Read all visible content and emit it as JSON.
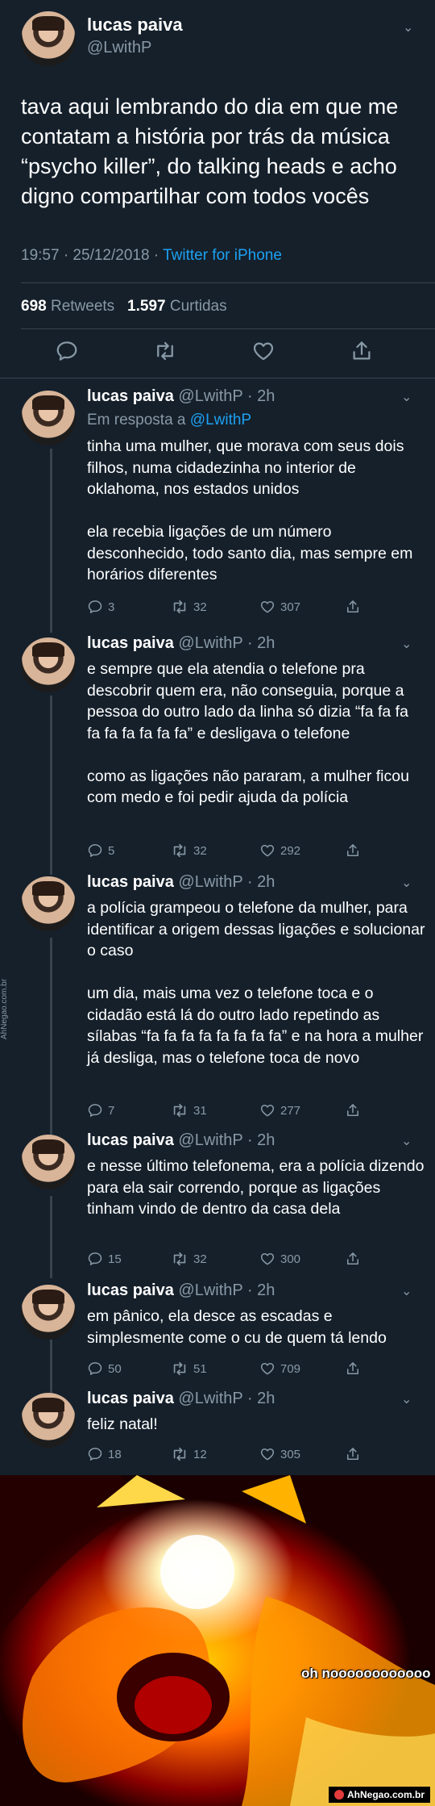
{
  "main_tweet": {
    "name": "lucas paiva",
    "handle": "@LwithP",
    "text": "tava aqui lembrando do dia em que me contatam a história por trás da música “psycho killer”, do talking heads e acho digno compartilhar com todos vocês",
    "time": "19:57 · 25/12/2018 · ",
    "client": "Twitter for iPhone",
    "retweets_count": "698",
    "retweets_label": "Retweets",
    "likes_count": "1.597",
    "likes_label": "Curtidas"
  },
  "replies": [
    {
      "name": "lucas paiva",
      "handle": "@LwithP · 2h",
      "in_reply_prefix": "Em resposta a ",
      "in_reply_to": "@LwithP",
      "text": "tinha uma mulher, que morava com seus dois filhos, numa cidadezinha no interior de oklahoma, nos estados unidos\n\nela recebia ligações de um número desconhecido, todo santo dia, mas sempre em horários diferentes",
      "replies": "3",
      "retweets": "32",
      "likes": "307"
    },
    {
      "name": "lucas paiva",
      "handle": "@LwithP · 2h",
      "text": "e sempre que ela atendia o telefone pra descobrir quem era, não conseguia, porque a pessoa do outro lado da linha só dizia “fa fa fa fa fa fa fa fa fa” e desligava o telefone\n\ncomo as ligações não pararam, a mulher ficou com medo e foi pedir ajuda da polícia",
      "replies": "5",
      "retweets": "32",
      "likes": "292"
    },
    {
      "name": "lucas paiva",
      "handle": "@LwithP · 2h",
      "text": "a polícia grampeou o telefone da mulher, para identificar a origem dessas ligações e solucionar o caso\n\num dia, mais uma vez o telefone toca e o cidadão está lá do outro lado repetindo as sílabas “fa fa fa fa fa fa fa fa” e na hora a mulher já desliga, mas o telefone toca de novo",
      "replies": "7",
      "retweets": "31",
      "likes": "277"
    },
    {
      "name": "lucas paiva",
      "handle": "@LwithP · 2h",
      "text": "e nesse último telefonema, era a polícia dizendo para ela sair correndo, porque as ligações tinham vindo de dentro da casa dela",
      "replies": "15",
      "retweets": "32",
      "likes": "300"
    },
    {
      "name": "lucas paiva",
      "handle": "@LwithP · 2h",
      "text": "em pânico, ela desce as escadas e simplesmente come o cu de quem tá lendo",
      "replies": "50",
      "retweets": "51",
      "likes": "709"
    },
    {
      "name": "lucas paiva",
      "handle": "@LwithP · 2h",
      "text": "feliz natal!",
      "replies": "18",
      "retweets": "12",
      "likes": "305"
    }
  ],
  "meme": {
    "caption": "oh noooooooooooo",
    "watermark": "AhNegao.com.br"
  },
  "side_watermark": "AhNegao.com.br",
  "colors": {
    "background": "#15202b",
    "accent": "#1da1f2",
    "secondary_text": "#8899a6",
    "divider": "#38444d"
  },
  "icons": {
    "reply": "reply-icon",
    "retweet": "retweet-icon",
    "like": "heart-icon",
    "share": "share-icon",
    "caret": "chevron-down-icon"
  }
}
